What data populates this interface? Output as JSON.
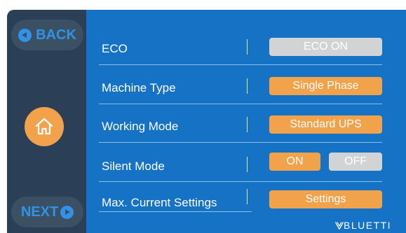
{
  "nav": {
    "back_label": "BACK",
    "next_label": "NEXT"
  },
  "settings": {
    "eco": {
      "label": "ECO",
      "button": "ECO ON"
    },
    "machine_type": {
      "label": "Machine Type",
      "button": "Single Phase"
    },
    "working_mode": {
      "label": "Working Mode",
      "button": "Standard UPS"
    },
    "silent_mode": {
      "label": "Silent Mode",
      "on_label": "ON",
      "off_label": "OFF"
    },
    "max_current": {
      "label": "Max. Current Settings",
      "button": "Settings"
    }
  },
  "brand": {
    "logo_text": "BLUETTI"
  },
  "colors": {
    "sidebar": "#2b4057",
    "main_panel": "#1672c4",
    "accent_orange": "#f2a24a",
    "nav_blue": "#2f93e8",
    "disabled_gray": "#d2d3d5"
  },
  "icons": [
    "back-arrow-icon",
    "next-arrow-icon",
    "home-icon"
  ]
}
